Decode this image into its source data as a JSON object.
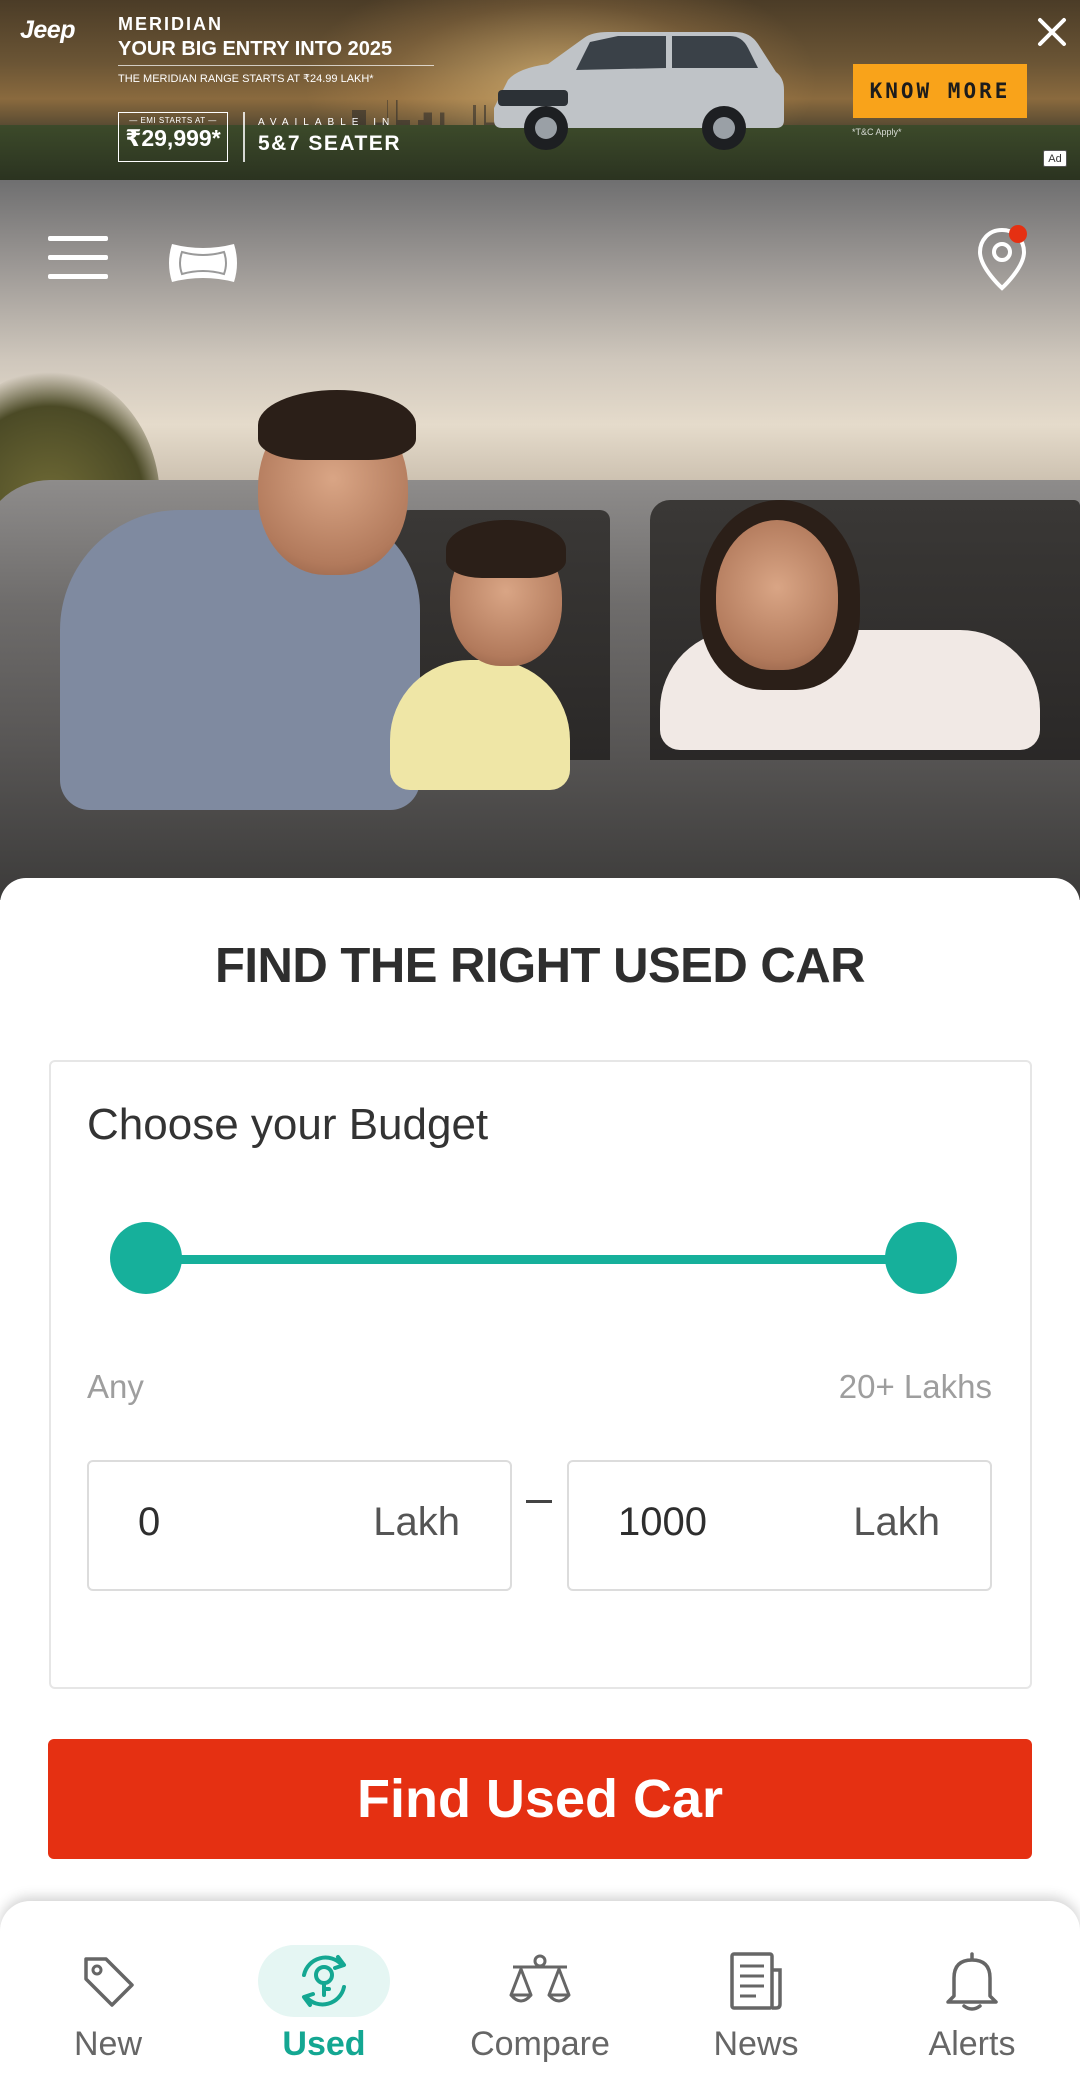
{
  "ad": {
    "brand": "Jeep",
    "model": "MERIDIAN",
    "headline": "YOUR BIG ENTRY INTO 2025",
    "subtext": "THE MERIDIAN RANGE STARTS AT ₹24.99 LAKH*",
    "emi_label": "— EMI STARTS AT —",
    "emi_price": "₹29,999*",
    "available_label": "AVAILABLE IN",
    "seater": "5&7 SEATER",
    "cta": "KNOW MORE",
    "terms": "*T&C Apply*",
    "ad_badge": "Ad",
    "colors": {
      "cta_bg": "#f9a31a"
    }
  },
  "header": {
    "menu_icon": "hamburger-menu-icon",
    "logo_icon": "carwale-logo-icon",
    "location_icon": "location-pin-icon",
    "location_dot_color": "#e53012"
  },
  "main": {
    "title": "FIND THE RIGHT USED CAR",
    "budget": {
      "label": "Choose your Budget",
      "slider_min_fraction": 0,
      "slider_max_fraction": 1,
      "range_min_label": "Any",
      "range_max_label": "20+ Lakhs",
      "min_value": "0",
      "min_unit": "Lakh",
      "max_value": "1000",
      "max_unit": "Lakh"
    },
    "cta": "Find Used Car",
    "colors": {
      "accent": "#16b09b",
      "cta": "#e53012"
    }
  },
  "bottom_nav": {
    "items": [
      {
        "label": "New",
        "icon": "price-tag-icon",
        "active": false
      },
      {
        "label": "Used",
        "icon": "used-car-key-icon",
        "active": true
      },
      {
        "label": "Compare",
        "icon": "balance-scale-icon",
        "active": false
      },
      {
        "label": "News",
        "icon": "newspaper-icon",
        "active": false
      },
      {
        "label": "Alerts",
        "icon": "bell-icon",
        "active": false
      }
    ]
  }
}
